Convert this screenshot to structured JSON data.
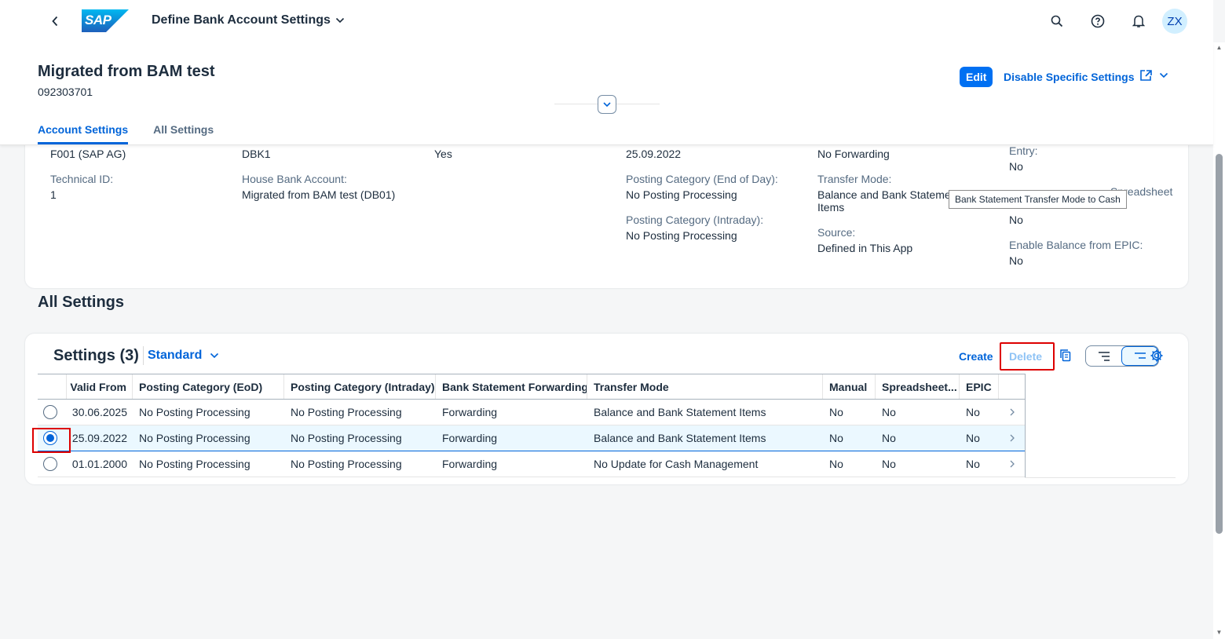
{
  "shell": {
    "logo_text": "SAP",
    "app_title": "Define Bank Account Settings",
    "avatar": "ZX",
    "icons": [
      "back-icon",
      "chevron-down-icon",
      "search-icon",
      "help-icon",
      "bell-icon"
    ]
  },
  "header": {
    "title": "Migrated from BAM test",
    "subtitle": "092303701",
    "edit_label": "Edit",
    "disable_label": "Disable Specific Settings",
    "tabs": [
      {
        "label": "Account Settings",
        "active": true
      },
      {
        "label": "All Settings",
        "active": false
      }
    ]
  },
  "form": {
    "col1_value1": "F001 (SAP AG)",
    "tech_id_label": "Technical ID:",
    "tech_id_value": "1",
    "col2_value1": "DBK1",
    "house_bank_label": "House Bank Account:",
    "house_bank_value": "Migrated from BAM test (DB01)",
    "col3_value1": "Yes",
    "col4_value1": "25.09.2022",
    "eod_label": "Posting Category (End of Day):",
    "eod_value": "No Posting Processing",
    "intraday_label": "Posting Category (Intraday):",
    "intraday_value": "No Posting Processing",
    "col5_value1": "No Forwarding",
    "transfer_label": "Transfer Mode:",
    "transfer_value_line1": "Balance and Bank Stateme",
    "transfer_value_line2": "Items",
    "source_label": "Source:",
    "source_value": "Defined in This App",
    "entry_label": "Entry:",
    "entry_value": "No",
    "spreadsheet_label_partial": "Spreadsheet",
    "spreadsheet_value": "No",
    "epic_label": "Enable Balance from EPIC:",
    "epic_value": "No"
  },
  "tooltip": "Bank Statement Transfer Mode to Cash",
  "section_title": "All Settings",
  "table": {
    "title": "Settings (3)",
    "variant": "Standard",
    "create_label": "Create",
    "delete_label": "Delete",
    "columns": [
      "Valid From",
      "Posting Category (EoD)",
      "Posting Category (Intraday)",
      "Bank Statement Forwarding",
      "Transfer Mode",
      "Manual",
      "Spreadsheet...",
      "EPIC"
    ],
    "rows": [
      {
        "selected": false,
        "cells": [
          "30.06.2025",
          "No Posting Processing",
          "No Posting Processing",
          "Forwarding",
          "Balance and Bank Statement Items",
          "No",
          "No",
          "No"
        ]
      },
      {
        "selected": true,
        "cells": [
          "25.09.2022",
          "No Posting Processing",
          "No Posting Processing",
          "Forwarding",
          "Balance and Bank Statement Items",
          "No",
          "No",
          "No"
        ]
      },
      {
        "selected": false,
        "cells": [
          "01.01.2000",
          "No Posting Processing",
          "No Posting Processing",
          "Forwarding",
          "No Update for Cash Management",
          "No",
          "No",
          "No"
        ]
      }
    ]
  },
  "colors": {
    "brand": "#0070f2",
    "link": "#0064d9",
    "highlight": "#dd0000",
    "selected_row": "#ebf8ff"
  }
}
